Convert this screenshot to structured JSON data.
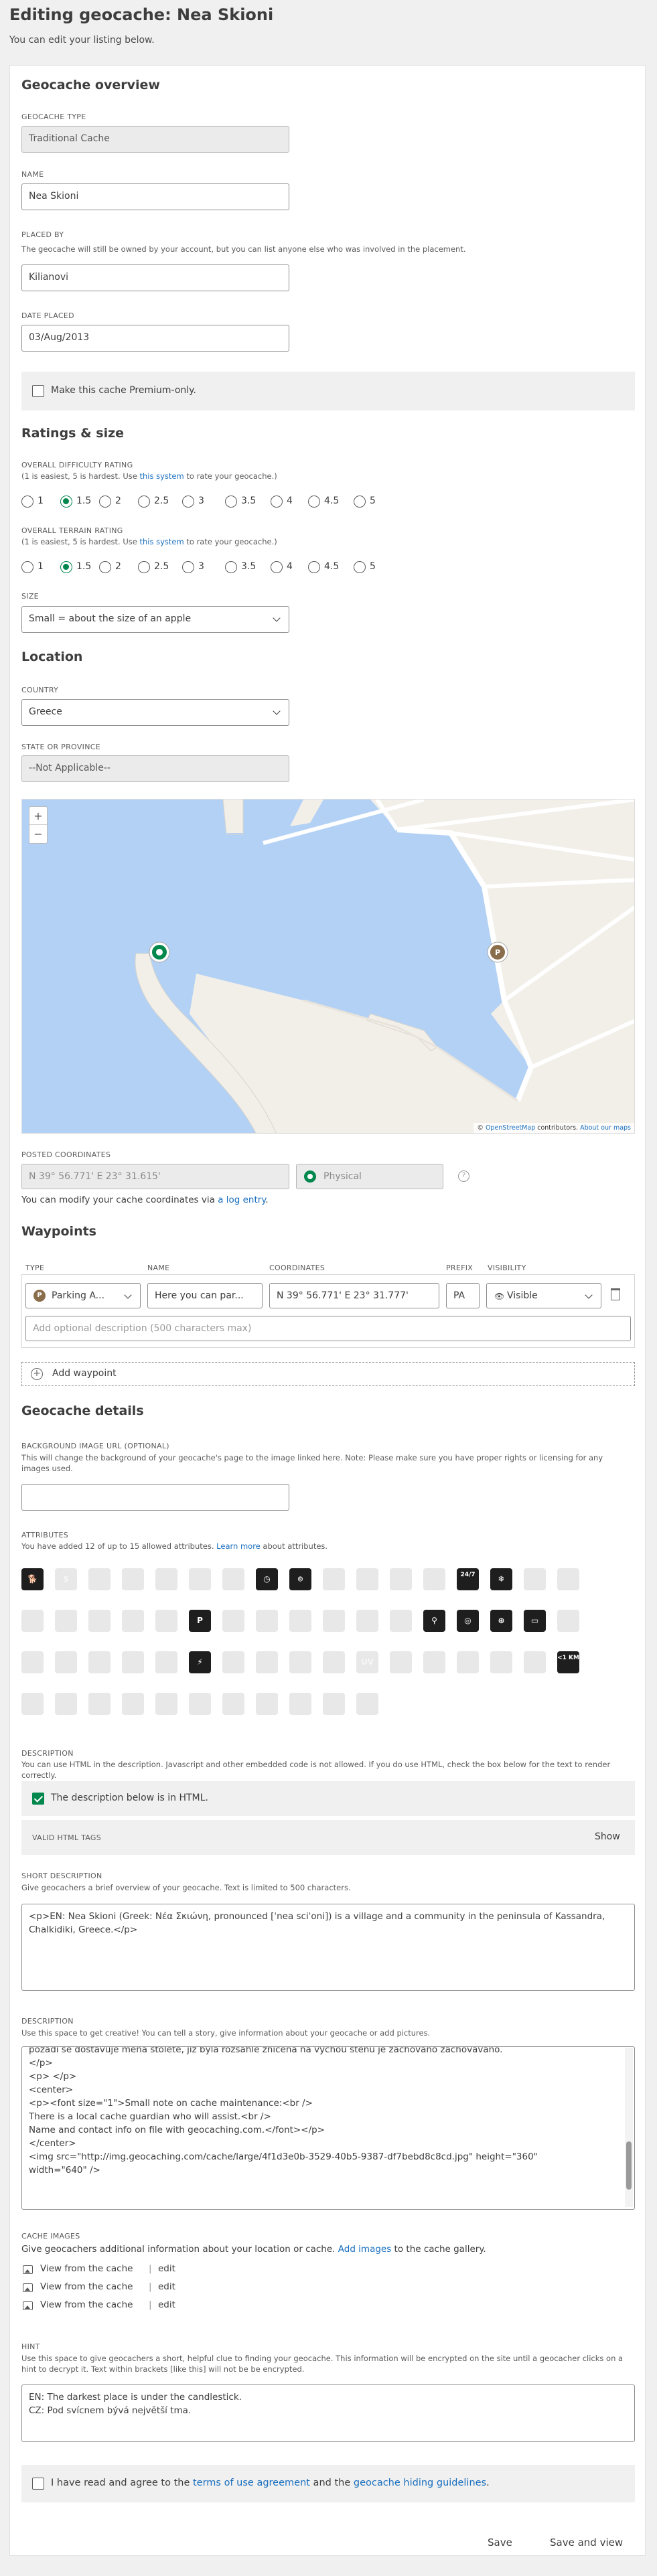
{
  "page": {
    "title": "Editing geocache: Nea Skioni",
    "subtitle": "You can edit your listing below."
  },
  "overview": {
    "heading": "Geocache overview",
    "type_label": "GEOCACHE TYPE",
    "type_value": "Traditional Cache",
    "name_label": "NAME",
    "name_value": "Nea Skioni",
    "placed_by_label": "PLACED BY",
    "placed_by_help": "The geocache will still be owned by your account, but you can list anyone else who was involved in the placement.",
    "placed_by_value": "Kilianovi",
    "date_label": "DATE PLACED",
    "date_value": "03/Aug/2013",
    "premium_label": "Make this cache Premium-only."
  },
  "ratings": {
    "heading": "Ratings & size",
    "difficulty_label": "OVERALL DIFFICULTY RATING",
    "help_prefix": "(1 is easiest, 5 is hardest. Use ",
    "help_link": "this system",
    "help_suffix": " to rate your geocache.)",
    "terrain_label": "OVERALL TERRAIN RATING",
    "options": [
      "1",
      "1.5",
      "2",
      "2.5",
      "3",
      "3.5",
      "4",
      "4.5",
      "5"
    ],
    "difficulty_selected": "1.5",
    "terrain_selected": "1.5",
    "size_label": "SIZE",
    "size_value": "Small = about the size of an apple"
  },
  "location": {
    "heading": "Location",
    "country_label": "COUNTRY",
    "country_value": "Greece",
    "state_label": "STATE OR PROVINCE",
    "state_value": "--Not Applicable--",
    "map_zoom_in": "+",
    "map_zoom_out": "−",
    "map_attribution_prefix": "© ",
    "map_attribution_link": "OpenStreetMap",
    "map_attribution_mid": " contributors. ",
    "map_attribution_about": "About our maps",
    "map_water_color": "#b3d1f5",
    "map_land_color": "#f2efe9",
    "posted_label": "POSTED COORDINATES",
    "coords_value": "N 39° 56.771' E 23° 31.615'",
    "coords_type": "Physical",
    "coords_help_prefix": "You can modify your cache coordinates via ",
    "coords_help_link": "a log entry",
    "coords_help_suffix": ".",
    "info_icon": "?"
  },
  "waypoints": {
    "heading": "Waypoints",
    "columns": [
      "TYPE",
      "NAME",
      "COORDINATES",
      "PREFIX",
      "VISIBILITY"
    ],
    "row": {
      "type": "Parking A...",
      "name": "Here you can par...",
      "coords": "N 39° 56.771' E 23° 31.777'",
      "prefix": "PA",
      "visibility": "Visible"
    },
    "description_placeholder": "Add optional description (500 characters max)",
    "add_label": "Add waypoint"
  },
  "details": {
    "heading": "Geocache details",
    "bg_label": "BACKGROUND IMAGE URL (OPTIONAL)",
    "bg_help": "This will change the background of your geocache's page to the image linked here. Note: Please make sure you have proper rights or licensing for any images used.",
    "attributes_label": "ATTRIBUTES",
    "attributes_help_prefix": "You have added 12 of up to 15 allowed attributes. ",
    "attributes_help_link": "Learn more",
    "attributes_help_suffix": " about attributes.",
    "attributes": [
      {
        "icon": "dog-icon",
        "on": true,
        "glyph": "🐕"
      },
      {
        "icon": "fee-icon",
        "on": false,
        "glyph": "$"
      },
      {
        "icon": "climbing-icon",
        "on": false,
        "glyph": ""
      },
      {
        "icon": "boat-icon",
        "on": false,
        "glyph": ""
      },
      {
        "icon": "scuba-icon",
        "on": false,
        "glyph": ""
      },
      {
        "icon": "wading-icon",
        "on": false,
        "glyph": ""
      },
      {
        "icon": "swimming-icon",
        "on": false,
        "glyph": ""
      },
      {
        "icon": "time-icon",
        "on": true,
        "glyph": "◷"
      },
      {
        "icon": "binoculars-icon",
        "on": true,
        "glyph": "⌾"
      },
      {
        "icon": "hiking-icon",
        "on": false,
        "glyph": ""
      },
      {
        "icon": "kids-icon",
        "on": false,
        "glyph": ""
      },
      {
        "icon": "scenic-icon",
        "on": false,
        "glyph": ""
      },
      {
        "icon": "hike-icon",
        "on": false,
        "glyph": ""
      },
      {
        "icon": "available-24-7-icon",
        "on": true,
        "glyph": "24/7"
      },
      {
        "icon": "snowflake-icon",
        "on": true,
        "glyph": "❄"
      },
      {
        "icon": "thorns-icon",
        "on": false,
        "glyph": ""
      },
      {
        "icon": "ticks-icon",
        "on": false,
        "glyph": ""
      },
      {
        "icon": "mine-icon",
        "on": false,
        "glyph": ""
      },
      {
        "icon": "cliff-icon",
        "on": false,
        "glyph": ""
      },
      {
        "icon": "hunting-icon",
        "on": false,
        "glyph": ""
      },
      {
        "icon": "danger-icon",
        "on": false,
        "glyph": ""
      },
      {
        "icon": "wheelchair-icon",
        "on": false,
        "glyph": ""
      },
      {
        "icon": "parking-icon",
        "on": true,
        "glyph": "P"
      },
      {
        "icon": "transit-icon",
        "on": false,
        "glyph": ""
      },
      {
        "icon": "water-icon",
        "on": false,
        "glyph": ""
      },
      {
        "icon": "restroom-icon",
        "on": false,
        "glyph": ""
      },
      {
        "icon": "phone-icon",
        "on": false,
        "glyph": ""
      },
      {
        "icon": "picnic-icon",
        "on": false,
        "glyph": ""
      },
      {
        "icon": "camping-icon",
        "on": false,
        "glyph": ""
      },
      {
        "icon": "bicycle-icon",
        "on": true,
        "glyph": "⚲"
      },
      {
        "icon": "motorcycle-icon",
        "on": true,
        "glyph": "◎"
      },
      {
        "icon": "quad-icon",
        "on": true,
        "glyph": "⊛"
      },
      {
        "icon": "jeep-icon",
        "on": true,
        "glyph": "▭"
      },
      {
        "icon": "snowmobile-icon",
        "on": false,
        "glyph": ""
      },
      {
        "icon": "horse-icon",
        "on": false,
        "glyph": ""
      },
      {
        "icon": "campfire-icon",
        "on": false,
        "glyph": ""
      },
      {
        "icon": "thorn-icon",
        "on": false,
        "glyph": ""
      },
      {
        "icon": "stealth-icon",
        "on": false,
        "glyph": ""
      },
      {
        "icon": "stroller-icon",
        "on": false,
        "glyph": ""
      },
      {
        "icon": "no-climbing-icon",
        "on": true,
        "glyph": "⚡"
      },
      {
        "icon": "cow-icon",
        "on": false,
        "glyph": ""
      },
      {
        "icon": "flashlight-icon",
        "on": false,
        "glyph": ""
      },
      {
        "icon": "lost-found-icon",
        "on": false,
        "glyph": ""
      },
      {
        "icon": "truck-icon",
        "on": false,
        "glyph": ""
      },
      {
        "icon": "uv-icon",
        "on": false,
        "glyph": "UV"
      },
      {
        "icon": "snowshoe-icon",
        "on": false,
        "glyph": ""
      },
      {
        "icon": "skiing-icon",
        "on": false,
        "glyph": ""
      },
      {
        "icon": "special-tool-icon",
        "on": false,
        "glyph": ""
      },
      {
        "icon": "night-icon",
        "on": false,
        "glyph": ""
      },
      {
        "icon": "park-icon",
        "on": false,
        "glyph": ""
      },
      {
        "icon": "short-hike-icon",
        "on": true,
        "glyph": "<1 KM"
      },
      {
        "icon": "medium-hike-icon",
        "on": false,
        "glyph": ""
      },
      {
        "icon": "long-hike-icon",
        "on": false,
        "glyph": ""
      },
      {
        "icon": "fuel-icon",
        "on": false,
        "glyph": ""
      },
      {
        "icon": "food-icon",
        "on": false,
        "glyph": ""
      },
      {
        "icon": "wireless-icon",
        "on": false,
        "glyph": ""
      },
      {
        "icon": "partnership-icon",
        "on": false,
        "glyph": ""
      },
      {
        "icon": "seasonal-icon",
        "on": false,
        "glyph": ""
      },
      {
        "icon": "tourist-icon",
        "on": false,
        "glyph": ""
      },
      {
        "icon": "tree-climbing-icon",
        "on": false,
        "glyph": ""
      },
      {
        "icon": "yard-icon",
        "on": false,
        "glyph": ""
      },
      {
        "icon": "teamwork-icon",
        "on": false,
        "glyph": ""
      }
    ],
    "desc_label": "DESCRIPTION",
    "desc_help": "You can use HTML in the description. Javascript and other embedded code is not allowed. If you do use HTML, check the box below for the text to render correctly.",
    "html_check_label": "The description below is in HTML.",
    "valid_tags_label": "VALID HTML TAGS",
    "show_label": "Show",
    "short_desc_label": "SHORT DESCRIPTION",
    "short_desc_help": "Give geocachers a brief overview of your geocache. Text is limited to 500 characters.",
    "short_desc_value": "<p>EN: Nea Skioni (Greek: Νέα Σκιώνη, pronounced [ˈnea sciˈoni]) is a village and a community in the peninsula of Kassandra, Chalkidiki, Greece.</p>",
    "long_desc_label": "DESCRIPTION",
    "long_desc_help": "Use this space to get creative! You can tell a story, give information about your geocache or add pictures.",
    "long_desc_lines": [
      "pozadí se dostavuje ména stoleté, již byla rozsáhle zničena na výchou stěnu je zachováno zachováváno.",
      "</p>",
      "<p> </p>",
      "<center>",
      "<p><font size=\"1\">Small note on cache maintenance:<br />",
      "There is a local cache guardian who will assist.<br />",
      "Name and contact info on file with geocaching.com.</font></p>",
      "</center>",
      "<img src=\"http://img.geocaching.com/cache/large/4f1d3e0b-3529-40b5-9387-df7bebd8c8cd.jpg\" height=\"360\"",
      "width=\"640\" />"
    ],
    "cache_images_label": "CACHE IMAGES",
    "cache_images_help_prefix": "Give geocachers additional information about your location or cache. ",
    "cache_images_help_link": "Add images",
    "cache_images_help_suffix": " to the cache gallery.",
    "cache_images": [
      {
        "label": "View from the cache",
        "edit": "edit"
      },
      {
        "label": "View from the cache",
        "edit": "edit"
      },
      {
        "label": "View from the cache",
        "edit": "edit"
      }
    ],
    "hint_label": "HINT",
    "hint_help": "Use this space to give geocachers a short, helpful clue to finding your geocache. This information will be encrypted on the site until a geocacher clicks on a hint to decrypt it. Text within brackets [like this] will not be be encrypted.",
    "hint_lines": [
      "EN: The darkest place is under the candlestick.",
      "CZ: Pod svícnem bývá největší tma."
    ],
    "agree_prefix": "I have read and agree to the ",
    "agree_link1": "terms of use agreement",
    "agree_mid": " and the ",
    "agree_link2": "geocache hiding guidelines",
    "agree_suffix": "."
  },
  "actions": {
    "save": "Save",
    "save_view": "Save and view"
  },
  "colors": {
    "accent": "#02874d",
    "link": "#1a6fbf",
    "page_bg": "#f0f0f0"
  }
}
